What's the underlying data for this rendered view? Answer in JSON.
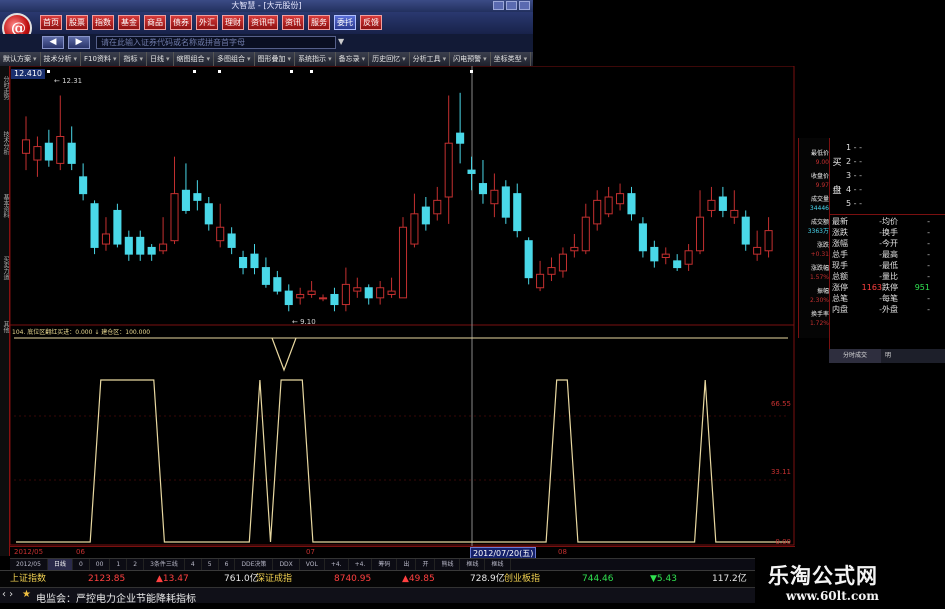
{
  "window": {
    "title": "大智慧 - [大元股份]"
  },
  "menu": {
    "items": [
      "首页",
      "股票",
      "指数",
      "基金",
      "商品",
      "债券",
      "外汇",
      "理财",
      "资讯中",
      "资讯",
      "服务",
      "委托",
      "反馈"
    ]
  },
  "nav": {
    "search_placeholder": "请在此输入证券代码或名称或拼音首字母",
    "back_label": "◀",
    "fwd_label": "▶"
  },
  "toolbar": {
    "items": [
      "默认方案",
      "技术分析",
      "F10资料",
      "指标",
      "日线",
      "缩图组合",
      "多图组合",
      "图形叠加",
      "系统指示",
      "备忘录",
      "历史回忆",
      "分析工具",
      "闪电预警",
      "坐标类型"
    ]
  },
  "left_tabs": [
    "分时走势",
    "技术分析",
    "基本资料",
    "买卖力道",
    "其他"
  ],
  "chart": {
    "price_tag": "12.410",
    "high_label": "12.31",
    "low_label": "9.10",
    "indicator_label": "104. 底位区翻红买进：0.000 ↓ 建仓区：100.000",
    "right_axis": [
      "66.55",
      "33.11",
      "0.00"
    ],
    "dates": [
      "2012/05",
      "06",
      "07",
      "08"
    ],
    "selected_date": "2012/07/20(五)"
  },
  "chart_data": {
    "type": "candlestick",
    "colors": {
      "up": "#c43030",
      "down": "#4ad8e8",
      "indicator": "#e8d8a0"
    },
    "price_range": [
      9.0,
      12.6
    ],
    "candles": [
      {
        "o": 11.45,
        "c": 11.65,
        "h": 12.0,
        "l": 11.2
      },
      {
        "o": 11.35,
        "c": 11.55,
        "h": 11.7,
        "l": 11.1
      },
      {
        "o": 11.6,
        "c": 11.35,
        "h": 11.8,
        "l": 11.25
      },
      {
        "o": 11.3,
        "c": 11.7,
        "h": 12.31,
        "l": 11.2
      },
      {
        "o": 11.6,
        "c": 11.3,
        "h": 11.85,
        "l": 11.2
      },
      {
        "o": 11.1,
        "c": 10.85,
        "h": 11.3,
        "l": 10.75
      },
      {
        "o": 10.7,
        "c": 10.05,
        "h": 10.75,
        "l": 9.95
      },
      {
        "o": 10.1,
        "c": 10.25,
        "h": 10.5,
        "l": 10.0
      },
      {
        "o": 10.6,
        "c": 10.1,
        "h": 10.7,
        "l": 10.05
      },
      {
        "o": 10.2,
        "c": 9.95,
        "h": 10.3,
        "l": 9.85
      },
      {
        "o": 10.2,
        "c": 9.95,
        "h": 10.3,
        "l": 9.85
      },
      {
        "o": 10.05,
        "c": 9.95,
        "h": 10.1,
        "l": 9.85
      },
      {
        "o": 10.0,
        "c": 10.1,
        "h": 10.5,
        "l": 9.95
      },
      {
        "o": 10.15,
        "c": 10.85,
        "h": 11.4,
        "l": 10.1
      },
      {
        "o": 10.9,
        "c": 10.6,
        "h": 11.3,
        "l": 10.55
      },
      {
        "o": 10.85,
        "c": 10.75,
        "h": 11.05,
        "l": 10.6
      },
      {
        "o": 10.7,
        "c": 10.4,
        "h": 10.8,
        "l": 10.3
      },
      {
        "o": 10.15,
        "c": 10.35,
        "h": 10.7,
        "l": 10.05
      },
      {
        "o": 10.25,
        "c": 10.05,
        "h": 10.35,
        "l": 9.95
      },
      {
        "o": 9.9,
        "c": 9.75,
        "h": 10.0,
        "l": 9.65
      },
      {
        "o": 9.95,
        "c": 9.75,
        "h": 10.1,
        "l": 9.65
      },
      {
        "o": 9.75,
        "c": 9.5,
        "h": 9.9,
        "l": 9.45
      },
      {
        "o": 9.6,
        "c": 9.4,
        "h": 9.7,
        "l": 9.35
      },
      {
        "o": 9.4,
        "c": 9.2,
        "h": 9.5,
        "l": 9.1
      },
      {
        "o": 9.3,
        "c": 9.35,
        "h": 9.45,
        "l": 9.2
      },
      {
        "o": 9.35,
        "c": 9.4,
        "h": 9.55,
        "l": 9.3
      },
      {
        "o": 9.3,
        "c": 9.3,
        "h": 9.35,
        "l": 9.25
      },
      {
        "o": 9.35,
        "c": 9.2,
        "h": 9.45,
        "l": 9.1
      },
      {
        "o": 9.2,
        "c": 9.5,
        "h": 9.75,
        "l": 9.1
      },
      {
        "o": 9.4,
        "c": 9.45,
        "h": 9.6,
        "l": 9.3
      },
      {
        "o": 9.45,
        "c": 9.3,
        "h": 9.5,
        "l": 9.2
      },
      {
        "o": 9.3,
        "c": 9.45,
        "h": 9.55,
        "l": 9.2
      },
      {
        "o": 9.35,
        "c": 9.4,
        "h": 9.6,
        "l": 9.3
      },
      {
        "o": 9.3,
        "c": 10.35,
        "h": 10.5,
        "l": 9.3
      },
      {
        "o": 10.1,
        "c": 10.55,
        "h": 10.85,
        "l": 10.05
      },
      {
        "o": 10.65,
        "c": 10.4,
        "h": 10.8,
        "l": 10.3
      },
      {
        "o": 10.55,
        "c": 10.75,
        "h": 10.95,
        "l": 10.45
      },
      {
        "o": 10.8,
        "c": 11.6,
        "h": 12.31,
        "l": 10.4
      },
      {
        "o": 11.75,
        "c": 11.6,
        "h": 12.35,
        "l": 11.3
      },
      {
        "o": 11.2,
        "c": 11.15,
        "h": 11.4,
        "l": 10.9
      },
      {
        "o": 11.0,
        "c": 10.85,
        "h": 11.35,
        "l": 10.7
      },
      {
        "o": 10.7,
        "c": 10.9,
        "h": 11.15,
        "l": 10.5
      },
      {
        "o": 10.95,
        "c": 10.5,
        "h": 11.05,
        "l": 10.4
      },
      {
        "o": 10.85,
        "c": 10.3,
        "h": 11.0,
        "l": 10.2
      },
      {
        "o": 10.15,
        "c": 9.6,
        "h": 10.2,
        "l": 9.5
      },
      {
        "o": 9.45,
        "c": 9.65,
        "h": 9.85,
        "l": 9.4
      },
      {
        "o": 9.65,
        "c": 9.75,
        "h": 9.9,
        "l": 9.55
      },
      {
        "o": 9.7,
        "c": 9.95,
        "h": 10.05,
        "l": 9.6
      },
      {
        "o": 10.0,
        "c": 10.05,
        "h": 10.25,
        "l": 9.9
      },
      {
        "o": 10.0,
        "c": 10.5,
        "h": 10.7,
        "l": 9.95
      },
      {
        "o": 10.4,
        "c": 10.75,
        "h": 10.9,
        "l": 10.3
      },
      {
        "o": 10.55,
        "c": 10.8,
        "h": 10.95,
        "l": 10.5
      },
      {
        "o": 10.7,
        "c": 10.85,
        "h": 11.0,
        "l": 10.6
      },
      {
        "o": 10.85,
        "c": 10.55,
        "h": 10.95,
        "l": 10.45
      },
      {
        "o": 10.4,
        "c": 10.0,
        "h": 10.5,
        "l": 9.9
      },
      {
        "o": 10.05,
        "c": 9.85,
        "h": 10.15,
        "l": 9.75
      },
      {
        "o": 9.9,
        "c": 9.95,
        "h": 10.05,
        "l": 9.8
      },
      {
        "o": 9.85,
        "c": 9.75,
        "h": 9.95,
        "l": 9.7
      },
      {
        "o": 9.8,
        "c": 10.0,
        "h": 10.1,
        "l": 9.7
      },
      {
        "o": 10.0,
        "c": 10.5,
        "h": 10.9,
        "l": 9.95
      },
      {
        "o": 10.6,
        "c": 10.75,
        "h": 10.95,
        "l": 10.5
      },
      {
        "o": 10.8,
        "c": 10.6,
        "h": 10.95,
        "l": 10.5
      },
      {
        "o": 10.5,
        "c": 10.6,
        "h": 10.9,
        "l": 10.4
      },
      {
        "o": 10.5,
        "c": 10.1,
        "h": 10.6,
        "l": 10.0
      },
      {
        "o": 9.95,
        "c": 10.05,
        "h": 10.3,
        "l": 9.85
      },
      {
        "o": 10.0,
        "c": 10.3,
        "h": 10.5,
        "l": 9.9
      }
    ],
    "indicator": {
      "name": "底位区翻红买进",
      "range": [
        0,
        100
      ],
      "values": [
        0,
        0,
        0,
        0,
        0,
        0,
        0,
        0,
        100,
        100,
        100,
        100,
        100,
        100,
        0,
        0,
        0,
        0,
        0,
        0,
        0,
        0,
        0,
        100,
        0,
        100,
        100,
        100,
        0,
        0,
        0,
        0,
        0,
        0,
        0,
        0,
        0,
        0,
        0,
        0,
        0,
        0,
        0,
        0,
        0,
        0,
        0,
        0,
        0,
        0,
        0,
        100,
        100,
        0,
        0,
        0,
        0,
        0,
        0,
        0,
        0,
        0,
        0,
        0,
        0,
        100,
        0,
        0,
        0,
        0,
        0,
        0,
        0,
        0
      ]
    }
  },
  "right_mid": [
    {
      "label": "最低价",
      "value": "9.00"
    },
    {
      "label": "收盘价",
      "value": "9.97"
    },
    {
      "label": "成交量",
      "value": "34446"
    },
    {
      "label": "成交额",
      "value": "3363万"
    },
    {
      "label": "涨跌",
      "value": "+0.31"
    },
    {
      "label": "涨跌幅",
      "value": "1.57%"
    },
    {
      "label": "振幅",
      "value": "2.30%"
    },
    {
      "label": "换手率",
      "value": "1.72%"
    }
  ],
  "quote": {
    "buy_side": "买",
    "sell_side": "盘",
    "levels": [
      "1",
      "2",
      "3",
      "4",
      "5"
    ],
    "rows": [
      {
        "a": "最新",
        "b": "-",
        "c": "均价",
        "d": "-"
      },
      {
        "a": "涨跌",
        "b": "-",
        "c": "换手",
        "d": "-"
      },
      {
        "a": "涨幅",
        "b": "-",
        "c": "今开",
        "d": "-"
      },
      {
        "a": "总手",
        "b": "-",
        "c": "最高",
        "d": "-"
      },
      {
        "a": "现手",
        "b": "-",
        "c": "最低",
        "d": "-"
      },
      {
        "a": "总额",
        "b": "-",
        "c": "量比",
        "d": "-"
      },
      {
        "a": "涨停",
        "b": "1163",
        "c": "跌停",
        "d": "951"
      },
      {
        "a": "总笔",
        "b": "-",
        "c": "每笔",
        "d": "-"
      },
      {
        "a": "内盘",
        "b": "-",
        "c": "外盘",
        "d": "-"
      }
    ],
    "tabs": [
      "分时成交",
      "明"
    ]
  },
  "tabbar": {
    "items": [
      "2012/05",
      "日线",
      "0",
      "00",
      "1",
      "2",
      "3条件三线",
      "4",
      "5",
      "6",
      "DDE决策",
      "DDX",
      "VOL",
      "+4.",
      "+4.",
      "筹码",
      "出",
      "开",
      "熊线",
      "框线",
      "框线"
    ]
  },
  "index_bar": {
    "name": "上证指数",
    "value": "2123.85",
    "change": "▲13.47",
    "amount": "761.0亿",
    "name2": "深证成指",
    "value2": "8740.95",
    "change2": "▲49.85",
    "amount2": "728.9亿",
    "name3": "创业板指",
    "value3": "744.46",
    "change3": "▼5.43",
    "amount3": "117.2亿"
  },
  "ticker": {
    "arrows": "‹ ›",
    "text": "电监会：严控电力企业节能降耗指标"
  },
  "watermark": {
    "title": "乐淘公式网",
    "url": "www.60lt.com"
  }
}
